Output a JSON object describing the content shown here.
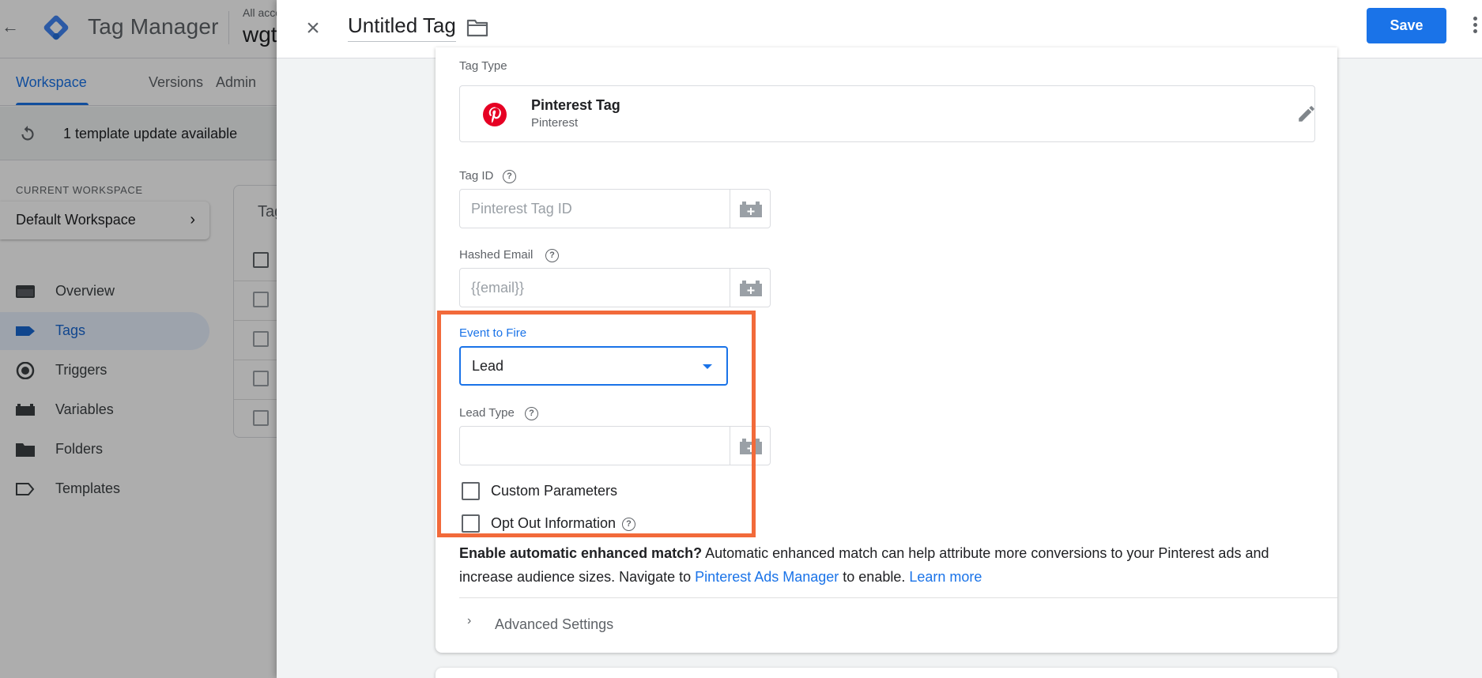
{
  "app": {
    "product_name": "Tag Manager",
    "account_small": "All accounts",
    "account_big": "wgt"
  },
  "tabs": [
    {
      "label": "Workspace",
      "active": true
    },
    {
      "label": "Versions",
      "active": false
    },
    {
      "label": "Admin",
      "active": false
    }
  ],
  "banner": {
    "text": "1 template update available"
  },
  "sidebar": {
    "current_workspace_label": "CURRENT WORKSPACE",
    "workspace_name": "Default Workspace",
    "items": [
      {
        "label": "Overview",
        "icon": "overview-icon",
        "active": false
      },
      {
        "label": "Tags",
        "icon": "tag-icon",
        "active": true
      },
      {
        "label": "Triggers",
        "icon": "trigger-icon",
        "active": false
      },
      {
        "label": "Variables",
        "icon": "variable-icon",
        "active": false
      },
      {
        "label": "Folders",
        "icon": "folder-icon",
        "active": false
      },
      {
        "label": "Templates",
        "icon": "template-icon",
        "active": false
      }
    ]
  },
  "bg_card": {
    "title": "Tag"
  },
  "editor": {
    "tag_name": "Untitled Tag",
    "save_label": "Save",
    "tag_type_label": "Tag Type",
    "tag_type": {
      "name": "Pinterest Tag",
      "vendor": "Pinterest",
      "icon": "pinterest-icon"
    },
    "tag_id": {
      "label": "Tag ID",
      "placeholder": "Pinterest Tag ID",
      "value": ""
    },
    "hashed_email": {
      "label": "Hashed Email",
      "value": "{{email}}"
    },
    "event_to_fire": {
      "label": "Event to Fire",
      "value": "Lead"
    },
    "lead_type": {
      "label": "Lead Type",
      "value": ""
    },
    "custom_parameters": {
      "label": "Custom Parameters",
      "checked": false
    },
    "opt_out": {
      "label": "Opt Out Information",
      "checked": false
    },
    "enhanced_match": {
      "bold": "Enable automatic enhanced match?",
      "text1": " Automatic enhanced match can help attribute more conversions to your Pinterest ads and increase audience sizes. Navigate to ",
      "link1": "Pinterest Ads Manager",
      "text2": " to enable. ",
      "link2": "Learn more"
    },
    "advanced_settings": "Advanced Settings"
  },
  "colors": {
    "accent": "#1a73e8",
    "highlight": "#f26a3a",
    "pinterest": "#e60023",
    "gtm_blue": "#4285f4"
  }
}
